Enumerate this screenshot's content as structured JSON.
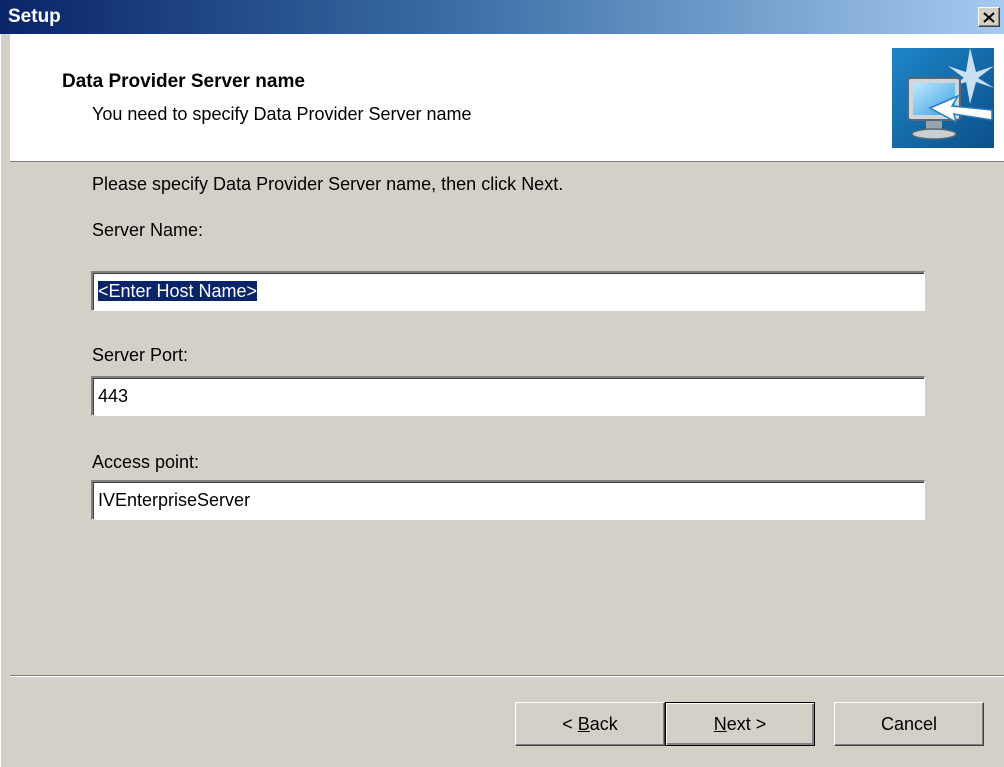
{
  "window": {
    "title": "Setup",
    "close_glyph": "✕"
  },
  "header": {
    "title": "Data Provider Server name",
    "subtitle": "You need to specify Data Provider Server name",
    "icon": "monitor-arrow-icon"
  },
  "body": {
    "instruction": "Please specify Data Provider Server name, then click Next.",
    "fields": [
      {
        "label": "Server Name:",
        "value": "<Enter Host Name>"
      },
      {
        "label": "Server Port:",
        "value": "443"
      },
      {
        "label": "Access point:",
        "value": "IVEnterpriseServer"
      }
    ]
  },
  "buttons": {
    "back_prefix": "< ",
    "back_mnemonic": "B",
    "back_rest": "ack",
    "next_mnemonic": "N",
    "next_rest": "ext >",
    "cancel": "Cancel"
  },
  "colors": {
    "title_gradient_start": "#0a246a",
    "title_gradient_end": "#a6caf0",
    "dialog_background": "#d4d0c8",
    "selection": "#0a246a"
  }
}
